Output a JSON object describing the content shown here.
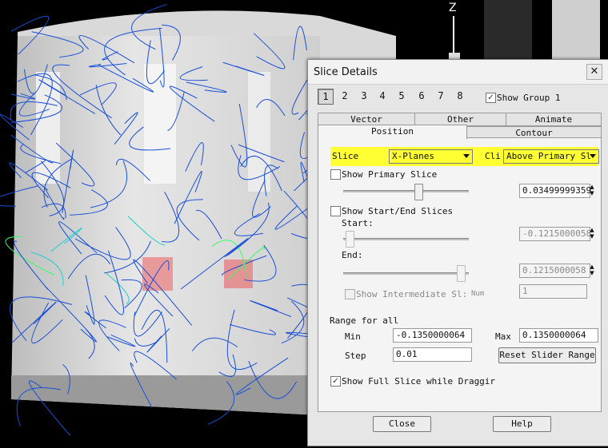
{
  "viewport": {
    "axis_label": "Z"
  },
  "dialog": {
    "title": "Slice Details",
    "close_glyph": "✕",
    "group_buttons": [
      "1",
      "2",
      "3",
      "4",
      "5",
      "6",
      "7",
      "8"
    ],
    "active_group": "1",
    "show_group_label": "Show Group 1",
    "show_group_checked": true,
    "tabs_row1": [
      "Vector",
      "Other",
      "Animate"
    ],
    "tabs_row2": [
      "Position",
      "Contour"
    ],
    "active_tab": "Position",
    "slice_label": "Slice",
    "slice_value": "X-Planes",
    "clip_label": "Cli",
    "clip_value": "Above Primary Sl",
    "show_primary_label": "Show Primary Slice",
    "primary_value": "0.03499999359",
    "primary_slider_fraction": 0.6,
    "show_start_end_label": "Show Start/End Slices",
    "start_label": "Start:",
    "start_value": "-0.1215000058",
    "end_label": "End:",
    "end_value": "0.1215000058",
    "show_intermediate_label": "Show Intermediate Sl:",
    "num_label": "Num",
    "num_value": "1",
    "range_label": "Range for all",
    "min_label": "Min",
    "min_value": "-0.1350000064",
    "max_label": "Max",
    "max_value": "0.1350000064",
    "step_label": "Step",
    "step_value": "0.01",
    "reset_label": "Reset Slider Range",
    "full_slice_label": "Show Full Slice while Draggir",
    "full_slice_checked": true,
    "close_label": "Close",
    "help_label": "Help",
    "checkmark": "✓",
    "spin_up": "▲",
    "spin_down": "▼"
  },
  "colors": {
    "highlight": "#ffff33",
    "streamline_blue": "#1a4fd6",
    "streamline_green": "#33ff66",
    "background": "#000000"
  }
}
